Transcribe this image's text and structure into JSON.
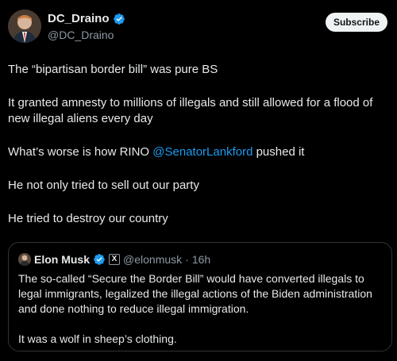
{
  "header": {
    "display_name": "DC_Draino",
    "handle": "@DC_Draino",
    "subscribe_label": "Subscribe"
  },
  "tweet": {
    "p1": "The “bipartisan border bill” was pure BS",
    "p2": "It granted amnesty to millions of illegals and still allowed for a flood of new illegal aliens every day",
    "p3_before": "What’s worse is how RINO ",
    "p3_mention": "@SenatorLankford",
    "p3_after": " pushed it",
    "p4": "He not only tried to sell out our party",
    "p5": "He tried to destroy our country"
  },
  "quote": {
    "name": "Elon Musk",
    "x_badge": "X",
    "handle": "@elonmusk",
    "separator": "·",
    "time": "16h",
    "p1": "The so-called “Secure the Border Bill” would have converted illegals to legal immigrants, legalized the illegal actions of the Biden administration and done nothing to reduce illegal immigration.",
    "p2": "It was a wolf in sheep’s clothing."
  },
  "colors": {
    "background": "#000000",
    "text": "#e7e9ea",
    "secondary": "#8b98a5",
    "link": "#1d9bf0",
    "verified": "#1d9bf0",
    "border": "#2f3336"
  },
  "icons": {
    "verified": "verified-badge-icon",
    "x": "x-logo-icon"
  }
}
